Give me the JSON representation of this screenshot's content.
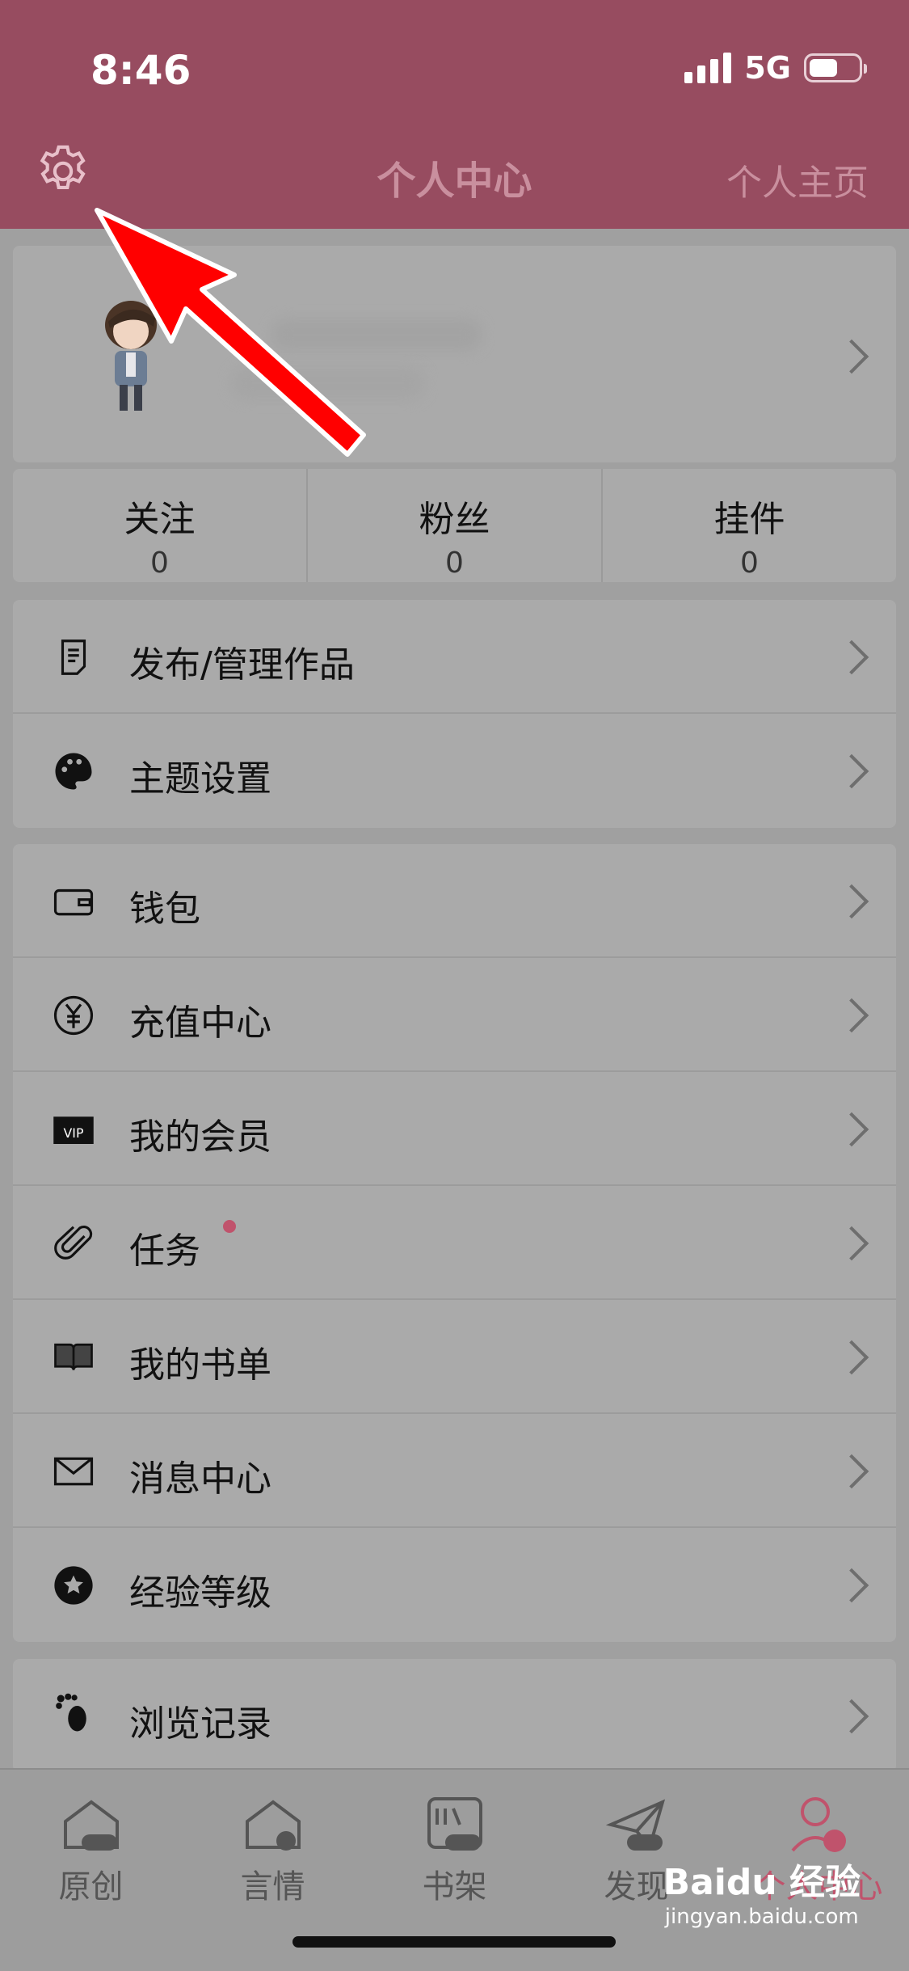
{
  "status": {
    "time": "8:46",
    "network": "5G"
  },
  "header": {
    "title": "个人中心",
    "home_link": "个人主页"
  },
  "profile": {},
  "stats": [
    {
      "label": "关注",
      "value": "0"
    },
    {
      "label": "粉丝",
      "value": "0"
    },
    {
      "label": "挂件",
      "value": "0"
    }
  ],
  "menu_group1": [
    {
      "label": "发布/管理作品",
      "icon": "document-icon"
    },
    {
      "label": "主题设置",
      "icon": "palette-icon"
    }
  ],
  "menu_group2": [
    {
      "label": "钱包",
      "icon": "wallet-icon"
    },
    {
      "label": "充值中心",
      "icon": "yuan-icon"
    },
    {
      "label": "我的会员",
      "icon": "vip-icon"
    },
    {
      "label": "任务",
      "icon": "paperclip-icon"
    },
    {
      "label": "我的书单",
      "icon": "book-icon"
    },
    {
      "label": "消息中心",
      "icon": "mail-icon"
    },
    {
      "label": "经验等级",
      "icon": "star-badge-icon"
    }
  ],
  "menu_group3": [
    {
      "label": "浏览记录",
      "icon": "footprint-icon"
    }
  ],
  "tabs": [
    {
      "label": "原创"
    },
    {
      "label": "言情"
    },
    {
      "label": "书架"
    },
    {
      "label": "发现"
    },
    {
      "label": "个人中心"
    }
  ],
  "watermark": {
    "main": "Baidu 经验",
    "sub": "jingyan.baidu.com"
  },
  "colors": {
    "header": "#974c60",
    "accent": "#c0536c",
    "annotation_arrow": "#ff0000"
  }
}
